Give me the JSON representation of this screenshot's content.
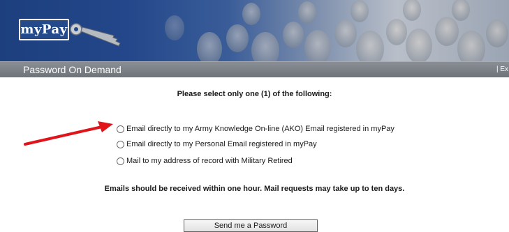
{
  "header": {
    "logo_text": "myPay",
    "page_title": "Password On Demand",
    "exit_link": "| Ex"
  },
  "main": {
    "prompt": "Please select only one (1) of the following:",
    "options": [
      {
        "label": "Email directly to my Army Knowledge On-line (AKO) Email registered in myPay",
        "selected": false
      },
      {
        "label": "Email directly to my Personal Email registered in myPay",
        "selected": false
      },
      {
        "label": "Mail to my address of record with Military Retired",
        "selected": false
      }
    ],
    "notice": "Emails should be received within one hour. Mail requests may take up to ten days.",
    "submit_label": "Send me a Password"
  },
  "colors": {
    "banner_blue": "#1d3f7e",
    "titlebar_gray": "#7a7f86",
    "arrow_red": "#e0141b"
  },
  "icons": {
    "logo": "key-icon",
    "annotation": "red-arrow-icon"
  }
}
